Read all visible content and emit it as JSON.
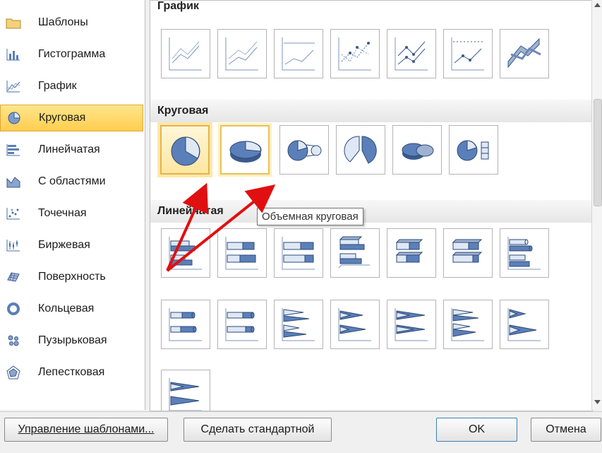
{
  "sidebar": {
    "items": [
      {
        "label": "Шаблоны",
        "icon": "folder-icon"
      },
      {
        "label": "Гистограмма",
        "icon": "column-chart-icon"
      },
      {
        "label": "График",
        "icon": "line-chart-icon"
      },
      {
        "label": "Круговая",
        "icon": "pie-chart-icon"
      },
      {
        "label": "Линейчатая",
        "icon": "bar-chart-icon"
      },
      {
        "label": "С областями",
        "icon": "area-chart-icon"
      },
      {
        "label": "Точечная",
        "icon": "scatter-chart-icon"
      },
      {
        "label": "Биржевая",
        "icon": "stock-chart-icon"
      },
      {
        "label": "Поверхность",
        "icon": "surface-chart-icon"
      },
      {
        "label": "Кольцевая",
        "icon": "doughnut-chart-icon"
      },
      {
        "label": "Пузырьковая",
        "icon": "bubble-chart-icon"
      },
      {
        "label": "Лепестковая",
        "icon": "radar-chart-icon"
      }
    ],
    "selected_label": "Круговая"
  },
  "gallery": {
    "section_line": "График",
    "section_pie": "Круговая",
    "section_bar": "Линейчатая"
  },
  "tooltip": "Объемная круговая",
  "buttons": {
    "manage_templates": "Управление шаблонами...",
    "set_default": "Сделать стандартной",
    "ok": "OK",
    "cancel": "Отмена"
  },
  "colors": {
    "selection": "#ffcd4f",
    "arrow": "#e01010",
    "chart_blue": "#4a6fa5"
  }
}
